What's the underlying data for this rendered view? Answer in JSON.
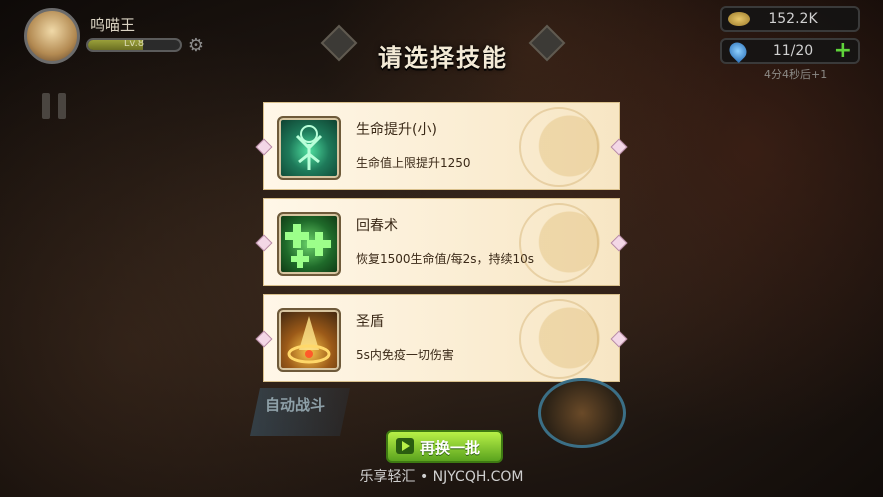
{
  "player": {
    "name": "呜喵王",
    "level_label": "Lv.8",
    "level_progress": 0.6
  },
  "resources": {
    "gold": "152.2K",
    "stamina": "11/20",
    "plus": "+",
    "timer": "4分4秒后+1"
  },
  "dialog": {
    "title": "请选择技能",
    "skills": [
      {
        "name": "生命提升(小)",
        "desc": "生命值上限提升1250"
      },
      {
        "name": "回春术",
        "desc": "恢复1500生命值/每2s，持续10s"
      },
      {
        "name": "圣盾",
        "desc": "5s内免疫一切伤害"
      }
    ],
    "refresh_label": "再换一批"
  },
  "hud": {
    "auto_battle": "自动战斗"
  },
  "watermark": "乐享轻汇 • NJYCQH.COM"
}
